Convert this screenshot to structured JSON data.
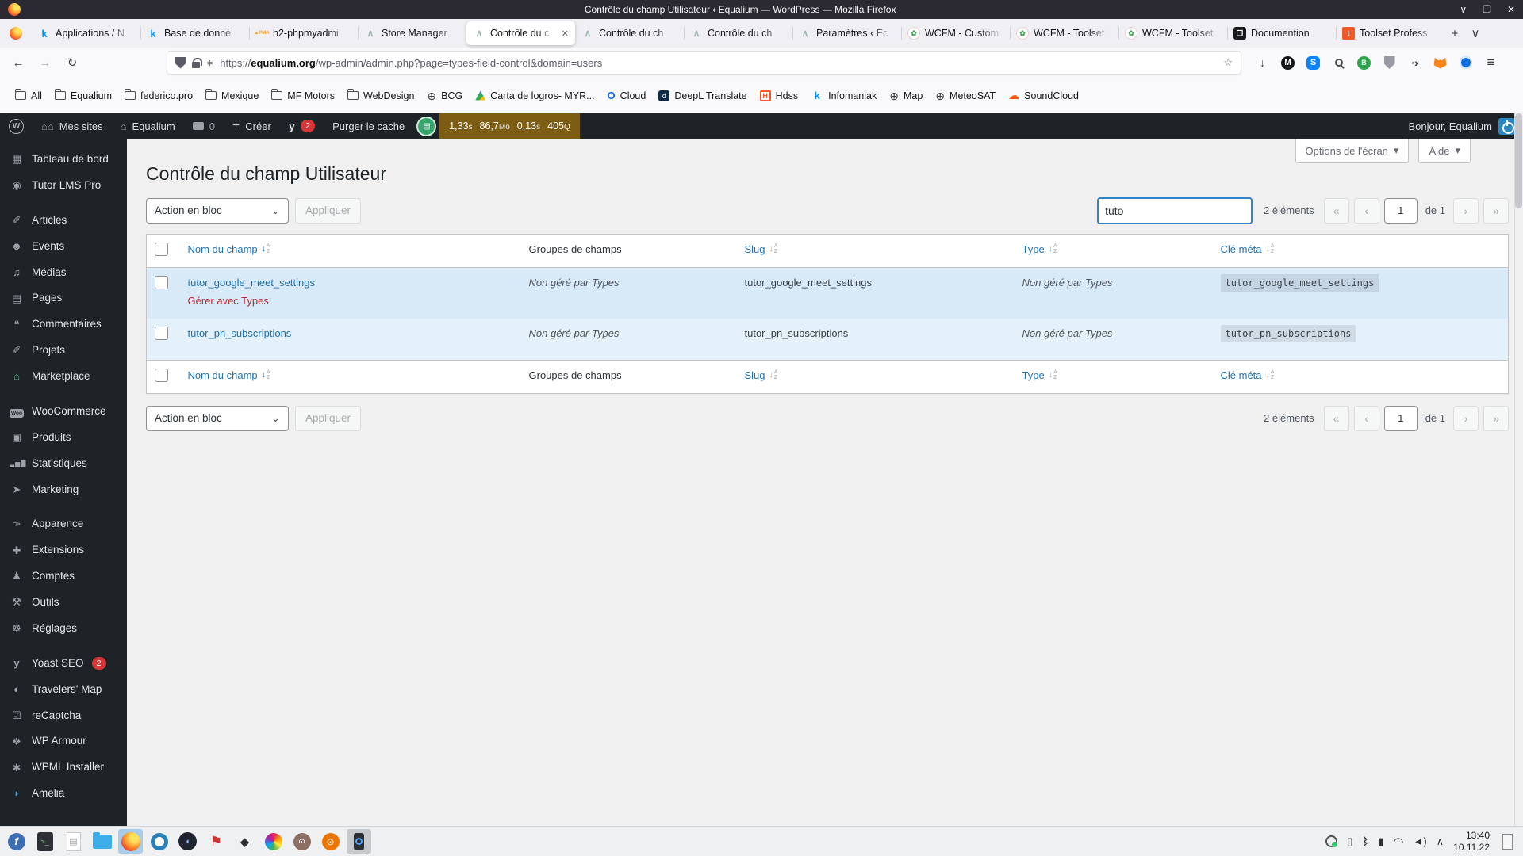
{
  "window": {
    "title": "Contrôle du champ Utilisateur ‹ Equalium — WordPress — Mozilla Firefox",
    "controls": {
      "minimize": "∨",
      "maximize": "❐",
      "close": "✕"
    }
  },
  "browser": {
    "tabs": [
      {
        "title": "Applications / N",
        "icon": "infomaniak-icon"
      },
      {
        "title": "Base de donné",
        "icon": "infomaniak-icon"
      },
      {
        "title": "h2-phpmyadmi",
        "icon": "phpmyadmin-icon"
      },
      {
        "title": "Store Manager",
        "icon": "equalium-icon"
      },
      {
        "title": "Contrôle du c",
        "icon": "equalium-icon",
        "active": true,
        "close": "✕"
      },
      {
        "title": "Contrôle du ch",
        "icon": "equalium-icon"
      },
      {
        "title": "Contrôle du ch",
        "icon": "equalium-icon"
      },
      {
        "title": "Paramètres ‹ Ec",
        "icon": "equalium-icon"
      },
      {
        "title": "WCFM - Custom",
        "icon": "wcfm-icon"
      },
      {
        "title": "WCFM - Toolset",
        "icon": "wcfm-icon"
      },
      {
        "title": "WCFM - Toolset",
        "icon": "wcfm-icon"
      },
      {
        "title": "Documention",
        "icon": "documention-icon"
      },
      {
        "title": "Toolset Profess",
        "icon": "toolset-icon"
      }
    ],
    "new_tab": "+",
    "tab_list": "∨",
    "nav": {
      "back": "←",
      "forward": "→",
      "reload": "↻",
      "star": "☆",
      "menu": "≡"
    },
    "url": {
      "scheme": "https://",
      "domain": "equalium.org",
      "path": "/wp-admin/admin.php?page=types-field-control&domain=users"
    },
    "bookmarks": [
      {
        "label": "All",
        "icon": "folder-icon"
      },
      {
        "label": "Equalium",
        "icon": "folder-icon"
      },
      {
        "label": "federico.pro",
        "icon": "folder-icon"
      },
      {
        "label": "Mexique",
        "icon": "folder-icon"
      },
      {
        "label": "MF Motors",
        "icon": "folder-icon"
      },
      {
        "label": "WebDesign",
        "icon": "folder-icon"
      },
      {
        "label": "BCG",
        "icon": "globe-icon"
      },
      {
        "label": "Carta de logros- MYR...",
        "icon": "gdrive-icon"
      },
      {
        "label": "Cloud",
        "icon": "cloud-icon"
      },
      {
        "label": "DeepL Translate",
        "icon": "deepl-icon"
      },
      {
        "label": "Hdss",
        "icon": "hdss-icon"
      },
      {
        "label": "Infomaniak",
        "icon": "infomaniak-icon"
      },
      {
        "label": "Map",
        "icon": "globe-icon"
      },
      {
        "label": "MeteoSAT",
        "icon": "globe-icon"
      },
      {
        "label": "SoundCloud",
        "icon": "soundcloud-icon"
      }
    ]
  },
  "adminbar": {
    "wp_logo": "W",
    "mes_sites": "Mes sites",
    "site_name": "Equalium",
    "comments_count": "0",
    "new_label": "Créer",
    "yoast_badge": "2",
    "purge_cache": "Purger le cache",
    "qm": {
      "time": "1,33",
      "time_unit": "s",
      "mem": "86,7",
      "mem_unit": "Mo",
      "db": "0,13",
      "db_unit": "s",
      "queries": "405",
      "q_unit": "Q"
    },
    "howdy": "Bonjour, Equalium"
  },
  "sidebar": {
    "items": [
      {
        "label": "Tableau de bord",
        "icon": "dashboard-icon"
      },
      {
        "label": "Tutor LMS Pro",
        "icon": "tutor-icon"
      },
      {
        "label": "Articles",
        "icon": "pin-icon"
      },
      {
        "label": "Events",
        "icon": "people-icon"
      },
      {
        "label": "Médias",
        "icon": "media-icon"
      },
      {
        "label": "Pages",
        "icon": "pages-icon"
      },
      {
        "label": "Commentaires",
        "icon": "comment-icon"
      },
      {
        "label": "Projets",
        "icon": "pin-icon"
      },
      {
        "label": "Marketplace",
        "icon": "store-icon"
      },
      {
        "label": "WooCommerce",
        "icon": "woo-icon",
        "woo_chip": "Woo"
      },
      {
        "label": "Produits",
        "icon": "box-icon"
      },
      {
        "label": "Statistiques",
        "icon": "chart-icon"
      },
      {
        "label": "Marketing",
        "icon": "megaphone-icon"
      },
      {
        "label": "Apparence",
        "icon": "brush-icon"
      },
      {
        "label": "Extensions",
        "icon": "plugin-icon"
      },
      {
        "label": "Comptes",
        "icon": "user-icon"
      },
      {
        "label": "Outils",
        "icon": "tools-icon"
      },
      {
        "label": "Réglages",
        "icon": "settings-icon"
      },
      {
        "label": "Yoast SEO",
        "icon": "yoast-icon",
        "badge": "2"
      },
      {
        "label": "Travelers' Map",
        "icon": "globe-icon"
      },
      {
        "label": "reCaptcha",
        "icon": "checkbox-icon"
      },
      {
        "label": "WP Armour",
        "icon": "shield-icon"
      },
      {
        "label": "WPML Installer",
        "icon": "gear-icon"
      },
      {
        "label": "Amelia",
        "icon": "amelia-icon"
      }
    ]
  },
  "page": {
    "screen_options": "Options de l'écran",
    "help": "Aide",
    "title": "Contrôle du champ Utilisateur",
    "bulk_action": "Action en bloc",
    "apply": "Appliquer",
    "search_value": "tuto",
    "count": "2 éléments",
    "pagination": {
      "first": "«",
      "prev": "‹",
      "page": "1",
      "of": "de 1",
      "next": "›",
      "last": "»"
    },
    "table": {
      "headers": {
        "name": "Nom du champ",
        "group": "Groupes de champs",
        "slug": "Slug",
        "type": "Type",
        "meta": "Clé méta"
      },
      "rows": [
        {
          "name": "tutor_google_meet_settings",
          "action": "Gérer avec Types",
          "group": "Non géré par Types",
          "slug": "tutor_google_meet_settings",
          "type": "Non géré par Types",
          "meta": "tutor_google_meet_settings"
        },
        {
          "name": "tutor_pn_subscriptions",
          "group": "Non géré par Types",
          "slug": "tutor_pn_subscriptions",
          "type": "Non géré par Types",
          "meta": "tutor_pn_subscriptions"
        }
      ]
    }
  },
  "taskbar": {
    "clock_time": "13:40",
    "clock_date": "10.11.22",
    "launchers": [
      "fedora-icon",
      "terminal-icon",
      "notes-icon",
      "files-icon",
      "firefox-icon",
      "okular-icon",
      "browser-dark-icon",
      "utility-red-icon",
      "diamond-app-icon",
      "color-sphere-icon",
      "gimp-icon",
      "blender-icon",
      "scrcpy-icon"
    ],
    "tray": [
      "headset-icon",
      "clipboard-icon",
      "bluetooth-icon",
      "battery-icon",
      "wifi-icon",
      "volume-icon",
      "expand-icon"
    ]
  }
}
